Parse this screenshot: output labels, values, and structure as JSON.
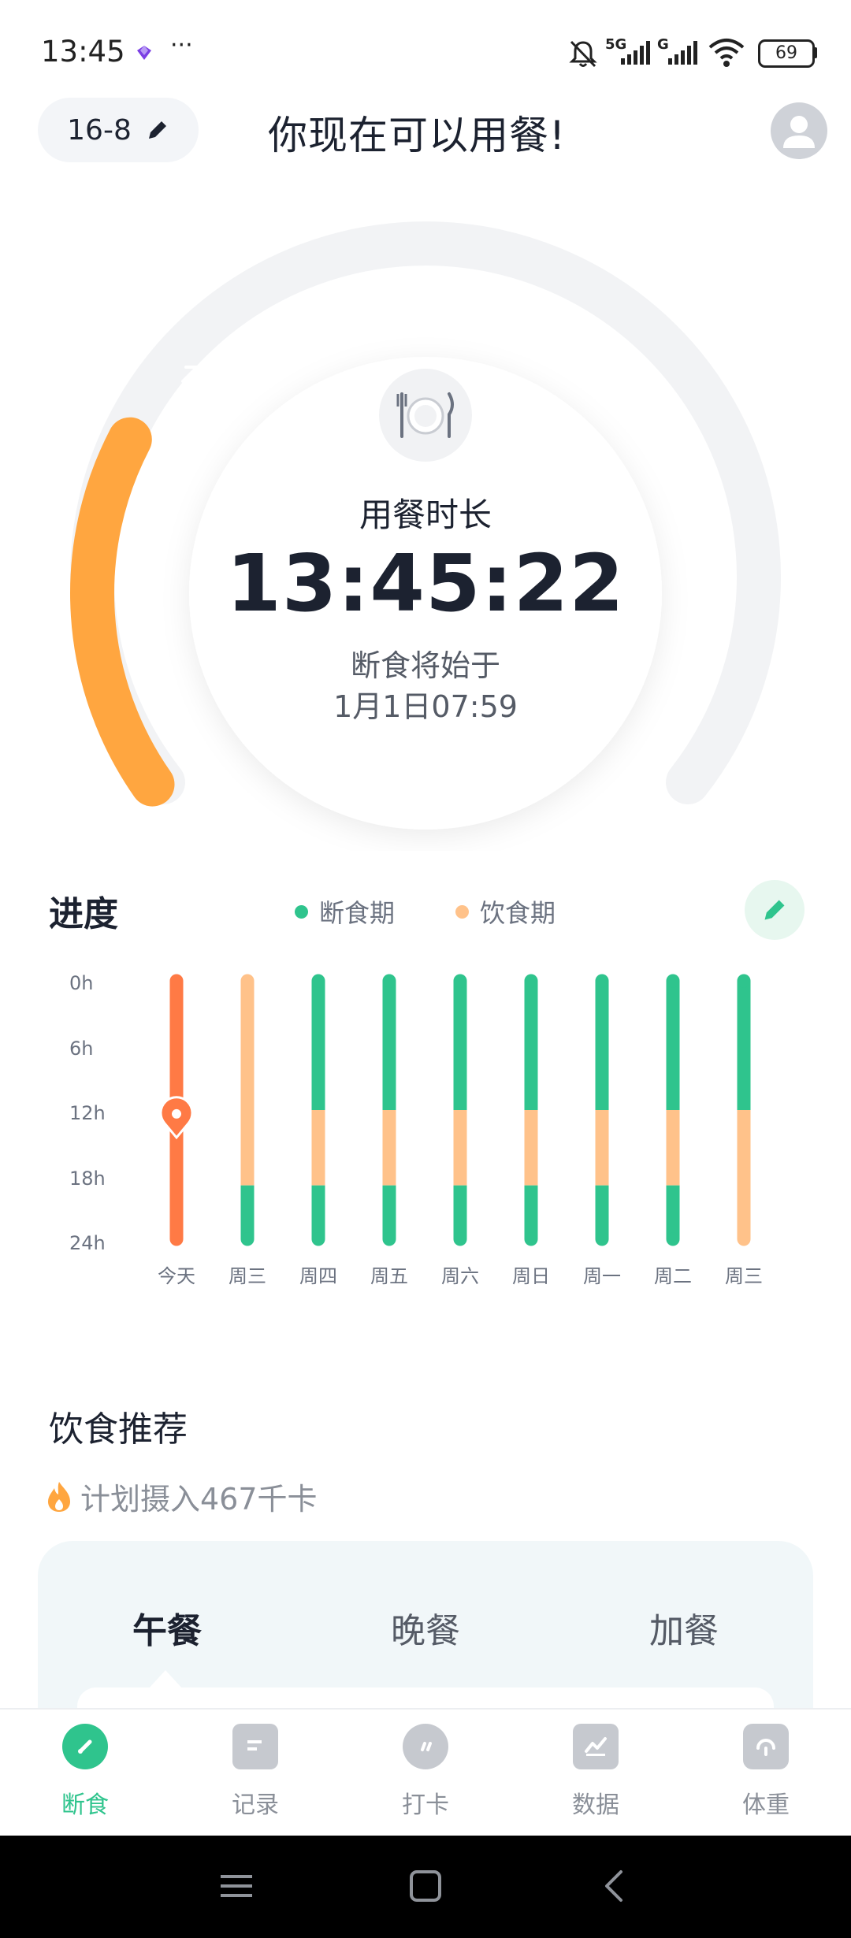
{
  "status_bar": {
    "time": "13:45",
    "more": "···",
    "network_5g": "5G",
    "network_g": "G",
    "battery": "69"
  },
  "header": {
    "plan": "16-8",
    "title": "你现在可以用餐!"
  },
  "timer_card": {
    "label": "用餐时长",
    "elapsed": "13:45:22",
    "next_label": "断食将始于",
    "next_time": "1月1日07:59",
    "eating_progress": 0.25,
    "colors": {
      "eating": "#FFA640",
      "track": "#F2F3F5"
    }
  },
  "progress": {
    "title": "进度",
    "legend": {
      "fasting": "断食期",
      "eating": "饮食期"
    },
    "colors": {
      "fasting": "#2FC48D",
      "eating": "#FFC28A",
      "today": "#FF7A45"
    },
    "y_labels": [
      "0h",
      "6h",
      "12h",
      "18h",
      "24h"
    ],
    "days": [
      {
        "label": "今天",
        "segments": [
          {
            "type": "today",
            "from": 0,
            "to": 24
          }
        ],
        "marker_hour": 12.8
      },
      {
        "label": "周三",
        "segments": [
          {
            "type": "eating",
            "from": 0,
            "to": 19
          },
          {
            "type": "fasting",
            "from": 19,
            "to": 24
          }
        ]
      },
      {
        "label": "周四",
        "segments": [
          {
            "type": "fasting",
            "from": 0,
            "to": 12
          },
          {
            "type": "eating",
            "from": 12,
            "to": 19
          },
          {
            "type": "fasting",
            "from": 19,
            "to": 24
          }
        ]
      },
      {
        "label": "周五",
        "segments": [
          {
            "type": "fasting",
            "from": 0,
            "to": 12
          },
          {
            "type": "eating",
            "from": 12,
            "to": 19
          },
          {
            "type": "fasting",
            "from": 19,
            "to": 24
          }
        ]
      },
      {
        "label": "周六",
        "segments": [
          {
            "type": "fasting",
            "from": 0,
            "to": 12
          },
          {
            "type": "eating",
            "from": 12,
            "to": 19
          },
          {
            "type": "fasting",
            "from": 19,
            "to": 24
          }
        ]
      },
      {
        "label": "周日",
        "segments": [
          {
            "type": "fasting",
            "from": 0,
            "to": 12
          },
          {
            "type": "eating",
            "from": 12,
            "to": 19
          },
          {
            "type": "fasting",
            "from": 19,
            "to": 24
          }
        ]
      },
      {
        "label": "周一",
        "segments": [
          {
            "type": "fasting",
            "from": 0,
            "to": 12
          },
          {
            "type": "eating",
            "from": 12,
            "to": 19
          },
          {
            "type": "fasting",
            "from": 19,
            "to": 24
          }
        ]
      },
      {
        "label": "周二",
        "segments": [
          {
            "type": "fasting",
            "from": 0,
            "to": 12
          },
          {
            "type": "eating",
            "from": 12,
            "to": 19
          },
          {
            "type": "fasting",
            "from": 19,
            "to": 24
          }
        ]
      },
      {
        "label": "周三",
        "segments": [
          {
            "type": "fasting",
            "from": 0,
            "to": 12
          },
          {
            "type": "eating",
            "from": 12,
            "to": 24
          }
        ]
      }
    ]
  },
  "diet": {
    "title": "饮食推荐",
    "calorie_text": "计划摄入467千卡",
    "tabs": [
      "午餐",
      "晚餐",
      "加餐"
    ]
  },
  "bottom_nav": {
    "items": [
      "断食",
      "记录",
      "打卡",
      "数据",
      "体重"
    ]
  }
}
